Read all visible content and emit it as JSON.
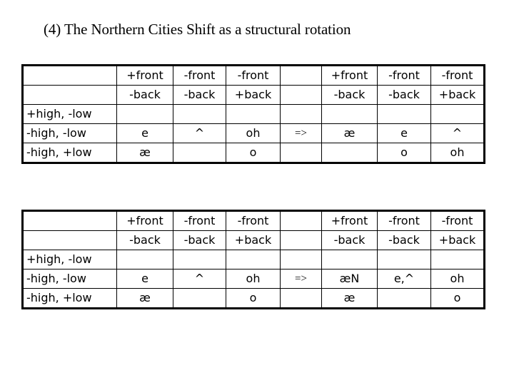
{
  "title": "(4) The Northern Cities Shift as a structural rotation",
  "tables": [
    {
      "header_row_1": [
        "",
        "+front",
        "-front",
        "-front",
        "",
        "+front",
        "-front",
        "-front"
      ],
      "header_row_2": [
        "",
        "-back",
        "-back",
        "+back",
        "",
        "-back",
        "-back",
        "+back"
      ],
      "rows": [
        {
          "label": "+high, -low",
          "cells": [
            "",
            "",
            "",
            "",
            "",
            "",
            ""
          ]
        },
        {
          "label": "-high, -low",
          "cells": [
            "e",
            "^",
            "oh",
            "=>",
            "æ",
            "e",
            "^"
          ]
        },
        {
          "label": "-high, +low",
          "cells": [
            "æ",
            "",
            "o",
            "",
            "",
            "o",
            "oh"
          ]
        }
      ]
    },
    {
      "header_row_1": [
        "",
        "+front",
        "-front",
        "-front",
        "",
        "+front",
        "-front",
        "-front"
      ],
      "header_row_2": [
        "",
        "-back",
        "-back",
        "+back",
        "",
        "-back",
        "-back",
        "+back"
      ],
      "rows": [
        {
          "label": "+high, -low",
          "cells": [
            "",
            "",
            "",
            "",
            "",
            "",
            ""
          ]
        },
        {
          "label": "-high, -low",
          "cells": [
            "e",
            "^",
            "oh",
            "=>",
            "æN",
            "e,^",
            "oh"
          ]
        },
        {
          "label": "-high, +low",
          "cells": [
            "æ",
            "",
            "o",
            "",
            "æ",
            "",
            "o"
          ]
        }
      ]
    }
  ]
}
